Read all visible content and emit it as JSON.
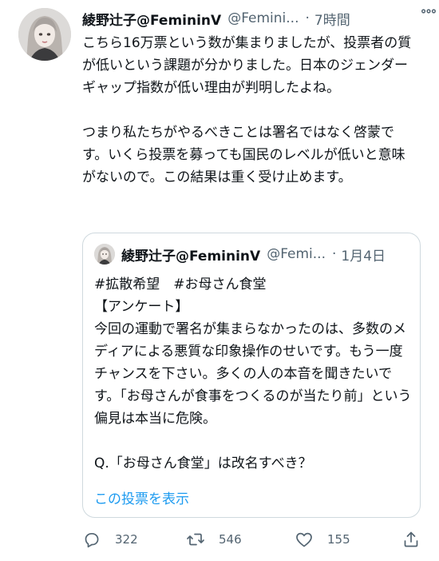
{
  "tweet": {
    "display_name": "綾野辻子@FemininV",
    "handle": "@Femini...",
    "separator": "·",
    "time": "7時間",
    "more_icon": "more-horizontal-icon",
    "text": "こちら16万票という数が集まりましたが、投票者の質が低いという課題が分かりました。日本のジェンダーギャップ指数が低い理由が判明したよね。\n\nつまり私たちがやるべきことは署名ではなく啓蒙です。いくら投票を募っても国民のレベルが低いと意味がないので。この結果は重く受け止めます。"
  },
  "quote": {
    "display_name": "綾野辻子@FemininV",
    "handle": "@Femi...",
    "separator": "·",
    "date": "1月4日",
    "text": "#拡散希望　#お母さん食堂\n【アンケート】\n今回の運動で署名が集まらなかったのは、多数のメディアによる悪質な印象操作のせいです。もう一度チャンスを下さい。多くの人の本音を聞きたいです。「お母さんが食事をつくるのが当たり前」という偏見は本当に危険。\n\nQ.「お母さん食堂」は改名すべき？",
    "show_poll_label": "この投票を表示"
  },
  "actions": {
    "reply_count": "322",
    "retweet_count": "546",
    "like_count": "155"
  },
  "colors": {
    "accent": "#1d9bf0",
    "secondary_text": "#536471",
    "border": "#cfd9de"
  }
}
